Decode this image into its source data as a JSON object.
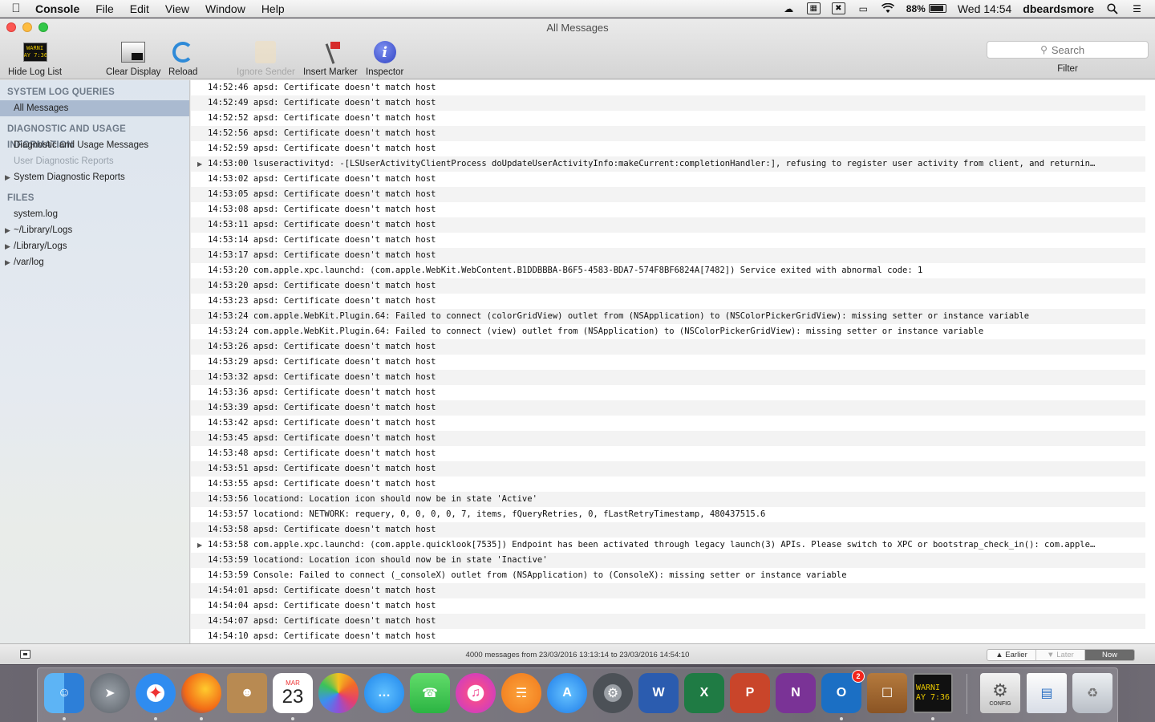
{
  "menubar": {
    "app": "Console",
    "menus": [
      "File",
      "Edit",
      "View",
      "Window",
      "Help"
    ],
    "battery": "88%",
    "battery_level": 0.88,
    "clock": "Wed 14:54",
    "user": "dbeardsmore"
  },
  "window": {
    "title": "All Messages"
  },
  "toolbar": {
    "hide_log_list": "Hide Log List",
    "warn_icon_text": "WARNI\nAY 7:36",
    "clear_display": "Clear Display",
    "reload": "Reload",
    "ignore_sender": "Ignore Sender",
    "insert_marker": "Insert Marker",
    "inspector": "Inspector",
    "search_placeholder": "Search",
    "filter_label": "Filter"
  },
  "sidebar": {
    "system_log_queries": "SYSTEM LOG QUERIES",
    "all_messages": "All Messages",
    "diagnostic_header": "DIAGNOSTIC AND USAGE INFORMATION",
    "diagnostic_messages": "Diagnostic and Usage Messages",
    "user_diagnostic_reports": "User Diagnostic Reports",
    "system_diagnostic_reports": "System Diagnostic Reports",
    "files_header": "FILES",
    "system_log": "system.log",
    "user_library_logs": "~/Library/Logs",
    "library_logs": "/Library/Logs",
    "var_log": "/var/log"
  },
  "log": [
    {
      "t": "14:52:46 apsd: Certificate doesn't match host"
    },
    {
      "t": "14:52:49 apsd: Certificate doesn't match host"
    },
    {
      "t": "14:52:52 apsd: Certificate doesn't match host"
    },
    {
      "t": "14:52:56 apsd: Certificate doesn't match host"
    },
    {
      "t": "14:52:59 apsd: Certificate doesn't match host"
    },
    {
      "t": "14:53:00 lsuseractivityd: -[LSUserActivityClientProcess doUpdateUserActivityInfo:makeCurrent:completionHandler:], refusing to register user activity from client, and returnin…",
      "expandable": true
    },
    {
      "t": "14:53:02 apsd: Certificate doesn't match host"
    },
    {
      "t": "14:53:05 apsd: Certificate doesn't match host"
    },
    {
      "t": "14:53:08 apsd: Certificate doesn't match host"
    },
    {
      "t": "14:53:11 apsd: Certificate doesn't match host"
    },
    {
      "t": "14:53:14 apsd: Certificate doesn't match host"
    },
    {
      "t": "14:53:17 apsd: Certificate doesn't match host"
    },
    {
      "t": "14:53:20 com.apple.xpc.launchd: (com.apple.WebKit.WebContent.B1DDBBBA-B6F5-4583-BDA7-574F8BF6824A[7482]) Service exited with abnormal code: 1"
    },
    {
      "t": "14:53:20 apsd: Certificate doesn't match host"
    },
    {
      "t": "14:53:23 apsd: Certificate doesn't match host"
    },
    {
      "t": "14:53:24 com.apple.WebKit.Plugin.64: Failed to connect (colorGridView) outlet from (NSApplication) to (NSColorPickerGridView): missing setter or instance variable"
    },
    {
      "t": "14:53:24 com.apple.WebKit.Plugin.64: Failed to connect (view) outlet from (NSApplication) to (NSColorPickerGridView): missing setter or instance variable"
    },
    {
      "t": "14:53:26 apsd: Certificate doesn't match host"
    },
    {
      "t": "14:53:29 apsd: Certificate doesn't match host"
    },
    {
      "t": "14:53:32 apsd: Certificate doesn't match host"
    },
    {
      "t": "14:53:36 apsd: Certificate doesn't match host"
    },
    {
      "t": "14:53:39 apsd: Certificate doesn't match host"
    },
    {
      "t": "14:53:42 apsd: Certificate doesn't match host"
    },
    {
      "t": "14:53:45 apsd: Certificate doesn't match host"
    },
    {
      "t": "14:53:48 apsd: Certificate doesn't match host"
    },
    {
      "t": "14:53:51 apsd: Certificate doesn't match host"
    },
    {
      "t": "14:53:55 apsd: Certificate doesn't match host"
    },
    {
      "t": "14:53:56 locationd: Location icon should now be in state 'Active'"
    },
    {
      "t": "14:53:57 locationd: NETWORK: requery, 0, 0, 0, 0, 7, items, fQueryRetries, 0, fLastRetryTimestamp, 480437515.6"
    },
    {
      "t": "14:53:58 apsd: Certificate doesn't match host"
    },
    {
      "t": "14:53:58 com.apple.xpc.launchd: (com.apple.quicklook[7535]) Endpoint has been activated through legacy launch(3) APIs. Please switch to XPC or bootstrap_check_in(): com.apple…",
      "expandable": true
    },
    {
      "t": "14:53:59 locationd: Location icon should now be in state 'Inactive'"
    },
    {
      "t": "14:53:59 Console: Failed to connect (_consoleX) outlet from (NSApplication) to (ConsoleX): missing setter or instance variable"
    },
    {
      "t": "14:54:01 apsd: Certificate doesn't match host"
    },
    {
      "t": "14:54:04 apsd: Certificate doesn't match host"
    },
    {
      "t": "14:54:07 apsd: Certificate doesn't match host"
    },
    {
      "t": "14:54:10 apsd: Certificate doesn't match host"
    }
  ],
  "statusbar": {
    "summary": "4000 messages from 23/03/2016 13:13:14 to 23/03/2016 14:54:10",
    "earlier": "Earlier",
    "later": "Later",
    "now": "Now"
  },
  "dock": {
    "calendar_month": "MAR",
    "calendar_day": "23",
    "outlook_badge": "2",
    "console_warn_text": "WARNI\nAY 7:36",
    "config_label": "CONFIG",
    "word_letter": "W",
    "excel_letter": "X",
    "powerpoint_letter": "P",
    "onenote_letter": "N",
    "outlook_letter": "O"
  },
  "colors": {
    "selection": "#aabad0",
    "sidebar_header": "#6e7a88",
    "accent_blue": "#2e8ad8"
  }
}
